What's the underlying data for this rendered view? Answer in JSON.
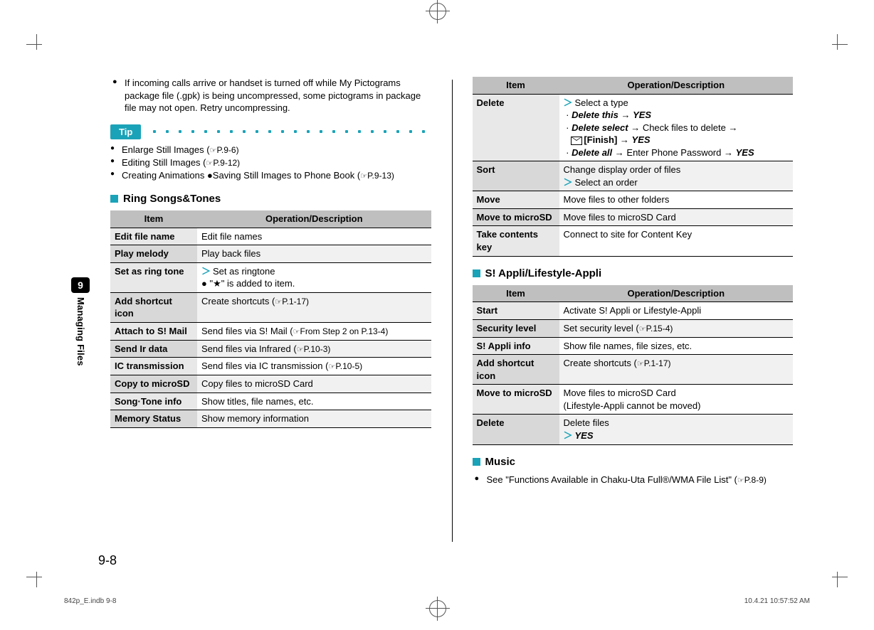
{
  "sidetab": {
    "chapter_num": "9",
    "chapter_label": "Managing Files"
  },
  "page_number": "9-8",
  "footer": {
    "left": "842p_E.indb   9-8",
    "right": "10.4.21   10:57:52 AM"
  },
  "note": {
    "bullet": "If incoming calls arrive or handset is turned off while My Pictograms package file (.gpk) is being uncompressed, some pictograms in package file may not open. Retry uncompressing."
  },
  "tip": {
    "chip": "Tip",
    "items": {
      "enlarge": "Enlarge Still Images (",
      "enlarge_ref": "P.9-6)",
      "edit": "Editing Still Images (",
      "edit_ref": "P.9-12)",
      "anim": "Creating Animations ●Saving Still Images to Phone Book (",
      "anim_ref": "P.9-13)"
    }
  },
  "ring": {
    "heading": "Ring Songs&Tones",
    "th_item": "Item",
    "th_op": "Operation/Description",
    "rows": [
      {
        "item": "Edit file name",
        "op": "Edit file names"
      },
      {
        "item": "Play melody",
        "op": "Play back files"
      },
      {
        "item": "Set as ring tone",
        "op_a": "Set as ringtone",
        "op_b": "\"★\" is added to item."
      },
      {
        "item": "Add shortcut icon",
        "op_pre": "Create shortcuts (",
        "op_ref": "P.1-17)"
      },
      {
        "item": "Attach to S! Mail",
        "op_pre": "Send files via S! Mail (",
        "op_ref": "From Step 2 on P.13-4)"
      },
      {
        "item": "Send Ir data",
        "op_pre": "Send files via Infrared (",
        "op_ref": "P.10-3)"
      },
      {
        "item": "IC transmission",
        "op_pre": "Send files via IC transmission (",
        "op_ref": "P.10-5)"
      },
      {
        "item": "Copy to microSD",
        "op": "Copy files to microSD Card"
      },
      {
        "item": "Song·Tone info",
        "op": "Show titles, file names, etc."
      },
      {
        "item": "Memory Status",
        "op": "Show memory information"
      }
    ]
  },
  "right_top": {
    "th_item": "Item",
    "th_op": "Operation/Description",
    "rows": {
      "delete_item": "Delete",
      "delete_sel": "Select a type",
      "delete_this": "Delete this",
      "delete_select": "Delete select",
      "delete_sel_tail": "Check files to delete",
      "finish": "[Finish]",
      "delete_all": "Delete all",
      "delete_all_tail": "Enter Phone Password",
      "yes": "YES",
      "sort_item": "Sort",
      "sort_op1": "Change display order of files",
      "sort_op2": "Select an order",
      "move_item": "Move",
      "move_op": "Move files to other folders",
      "mtsd_item": "Move to microSD",
      "mtsd_op": "Move files to microSD Card",
      "take_item": "Take contents key",
      "take_op": "Connect to site for Content Key"
    }
  },
  "appli": {
    "heading": "S! Appli/Lifestyle-Appli",
    "th_item": "Item",
    "th_op": "Operation/Description",
    "rows": {
      "start_item": "Start",
      "start_op": "Activate S! Appli or Lifestyle-Appli",
      "sec_item": "Security level",
      "sec_pre": "Set security level (",
      "sec_ref": "P.15-4)",
      "info_item": "S! Appli info",
      "info_op": "Show file names, file sizes, etc.",
      "short_item": "Add shortcut icon",
      "short_pre": "Create shortcuts (",
      "short_ref": "P.1-17)",
      "move_item": "Move to microSD",
      "move_op1": "Move files to microSD Card",
      "move_op2": "(Lifestyle-Appli cannot be moved)",
      "del_item": "Delete",
      "del_op": "Delete files",
      "del_yes": "YES"
    }
  },
  "music": {
    "heading": "Music",
    "text_pre": "See \"Functions Available in Chaku-Uta Full®/WMA File List\" (",
    "text_ref": "P.8-9)"
  }
}
